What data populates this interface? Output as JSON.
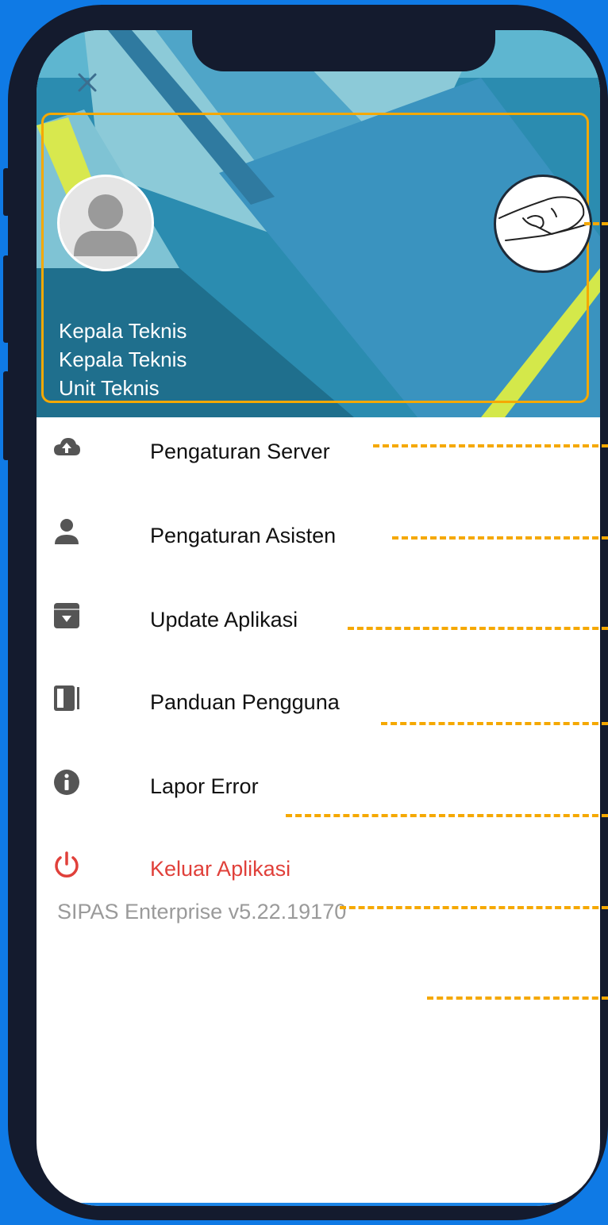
{
  "drawer": {
    "close_icon": "close-icon",
    "profile": {
      "avatar_icon": "user-avatar-icon",
      "signature_icon": "signature-icon",
      "lines": [
        "Kepala Teknis",
        "Kepala Teknis",
        "Unit Teknis"
      ]
    },
    "menu": [
      {
        "label": "Pengaturan Server",
        "icon": "cloud-upload-icon"
      },
      {
        "label": "Pengaturan Asisten",
        "icon": "person-icon"
      },
      {
        "label": "Update Aplikasi",
        "icon": "archive-download-icon"
      },
      {
        "label": "Panduan Pengguna",
        "icon": "book-icon"
      },
      {
        "label": "Lapor Error",
        "icon": "info-icon"
      },
      {
        "label": "Keluar Aplikasi",
        "icon": "power-icon"
      }
    ],
    "version": "SIPAS Enterprise v5.22.19170"
  },
  "colors": {
    "frame": "#141b2e",
    "background": "#0f7ae5",
    "highlight": "#f5a800",
    "danger": "#e0403a"
  }
}
